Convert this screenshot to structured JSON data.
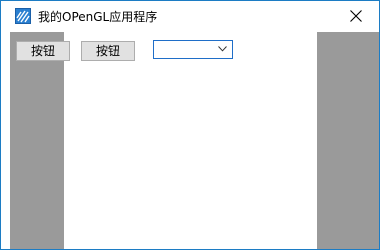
{
  "window": {
    "title": "我的OPenGL应用程序",
    "border_color": "#1c7cc4",
    "icon": "app-icon",
    "close_icon": "close-icon"
  },
  "toolbar": {
    "button1_label": "按钮",
    "button2_label": "按钮",
    "combo_value": "",
    "combo_icon": "chevron-down-icon"
  },
  "colors": {
    "side_panel": "#9a9a9a",
    "button_face": "#e1e1e1",
    "combo_border": "#1f6ec8"
  }
}
